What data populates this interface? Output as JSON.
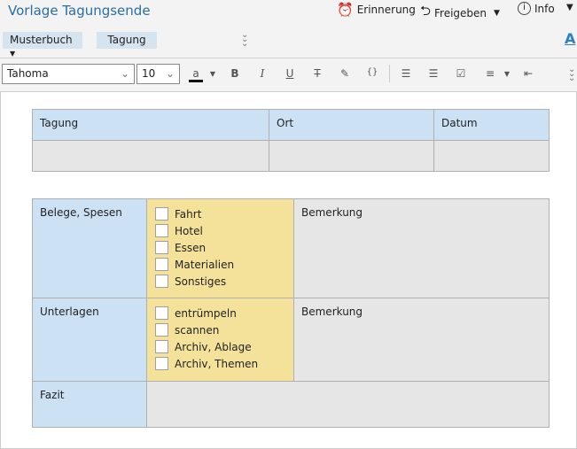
{
  "window": {
    "title": "Vorlage Tagungsende"
  },
  "header": {
    "reminder": "Erinnerung",
    "share": "Freigeben",
    "info": "Info"
  },
  "tags": {
    "notebook": "Musterbuch",
    "tag": "Tagung"
  },
  "toolbar": {
    "font": "Tahoma",
    "size": "10",
    "font_color_glyph": "a"
  },
  "table1": {
    "headers": [
      "Tagung",
      "Ort",
      "Datum"
    ],
    "row": [
      "",
      "",
      ""
    ]
  },
  "table2": {
    "rows": [
      {
        "label": "Belege, Spesen",
        "items": [
          "Fahrt",
          "Hotel",
          "Essen",
          "Materialien",
          "Sonstiges"
        ],
        "note": "Bemerkung"
      },
      {
        "label": "Unterlagen",
        "items": [
          "entrümpeln",
          "scannen",
          "Archiv, Ablage",
          "Archiv, Themen"
        ],
        "note": "Bemerkung"
      },
      {
        "label": "Fazit"
      }
    ]
  }
}
